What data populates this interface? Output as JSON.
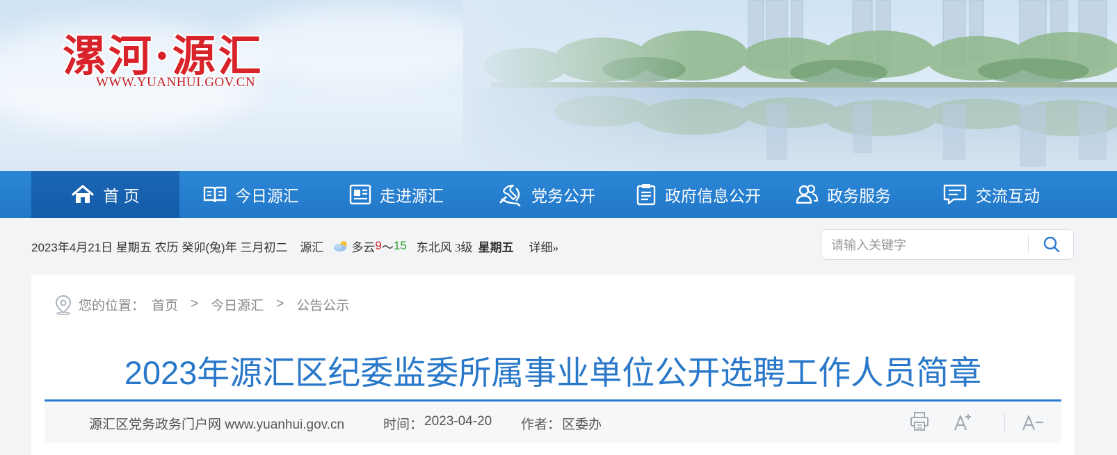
{
  "header": {
    "logo_title": "漯河·源汇",
    "logo_url": "WWW.YUANHUI.GOV.CN"
  },
  "nav": {
    "items": [
      {
        "label": "首 页",
        "icon": "home-icon",
        "active": true
      },
      {
        "label": "今日源汇",
        "icon": "book-icon"
      },
      {
        "label": "走进源汇",
        "icon": "news-icon"
      },
      {
        "label": "党务公开",
        "icon": "party-emblem-icon"
      },
      {
        "label": "政府信息公开",
        "icon": "clipboard-icon"
      },
      {
        "label": "政务服务",
        "icon": "users-icon"
      },
      {
        "label": "交流互动",
        "icon": "chat-icon"
      }
    ]
  },
  "infobar": {
    "date": "2023年4月21日 星期五 农历 癸卯(兔)年 三月初二",
    "city": "源汇",
    "weather": "多云",
    "temp_low": "9",
    "temp_sep": "～",
    "temp_high": "15",
    "wind": "东北风 3级",
    "weekday": "星期五",
    "detail": "详细»",
    "colors": {
      "temp_low": "#d8232a",
      "temp_high": "#2a9a2a"
    }
  },
  "search": {
    "placeholder": "请输入关键字"
  },
  "breadcrumb": {
    "prefix": "您的位置：",
    "items": [
      "首页",
      "今日源汇",
      "公告公示"
    ],
    "separator": ">"
  },
  "article": {
    "title": "2023年源汇区纪委监委所属事业单位公开选聘工作人员简章",
    "source": "源汇区党务政务门户网 www.yuanhui.gov.cn",
    "time_label": "时间：",
    "time": "2023-04-20",
    "author_label": "作者：",
    "author": "区委办",
    "tools": {
      "print": "print-icon",
      "font_increase": "A+",
      "font_decrease": "A−"
    }
  },
  "theme": {
    "nav_blue": "#2278c8",
    "title_blue": "#2a78c9",
    "logo_red": "#d8232a"
  }
}
